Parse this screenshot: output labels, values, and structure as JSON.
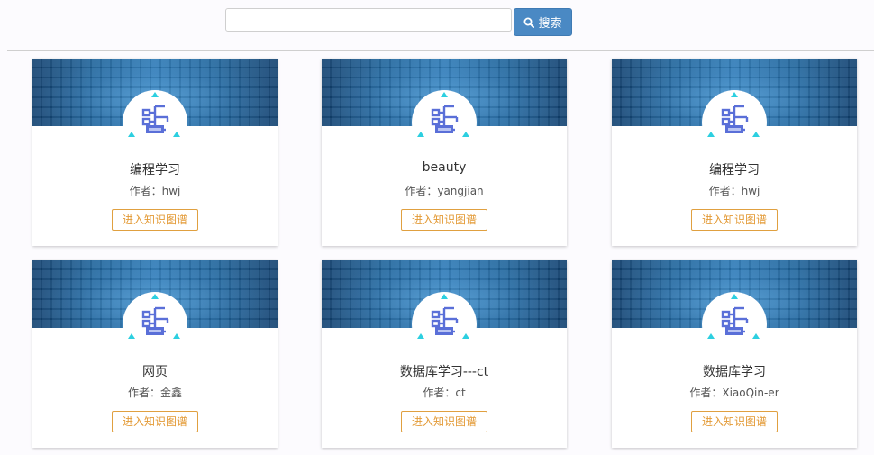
{
  "search": {
    "value": "",
    "placeholder": "",
    "button_label": "搜索"
  },
  "colors": {
    "accent": "#4a89c4",
    "button_outline": "#e39a36",
    "logo_blue": "#5a6fd8",
    "logo_cyan": "#2ccfe0"
  },
  "cards": [
    {
      "title": "编程学习",
      "author": "作者：hwj",
      "button_label": "进入知识图谱",
      "icon": "knowledge-graph-logo-icon"
    },
    {
      "title": "beauty",
      "author": "作者：yangjian",
      "button_label": "进入知识图谱",
      "icon": "knowledge-graph-logo-icon"
    },
    {
      "title": "编程学习",
      "author": "作者：hwj",
      "button_label": "进入知识图谱",
      "icon": "knowledge-graph-logo-icon"
    },
    {
      "title": "网页",
      "author": "作者：金鑫",
      "button_label": "进入知识图谱",
      "icon": "knowledge-graph-logo-icon"
    },
    {
      "title": "数据库学习---ct",
      "author": "作者：ct",
      "button_label": "进入知识图谱",
      "icon": "knowledge-graph-logo-icon"
    },
    {
      "title": "数据库学习",
      "author": "作者：XiaoQin-er",
      "button_label": "进入知识图谱",
      "icon": "knowledge-graph-logo-icon"
    }
  ]
}
